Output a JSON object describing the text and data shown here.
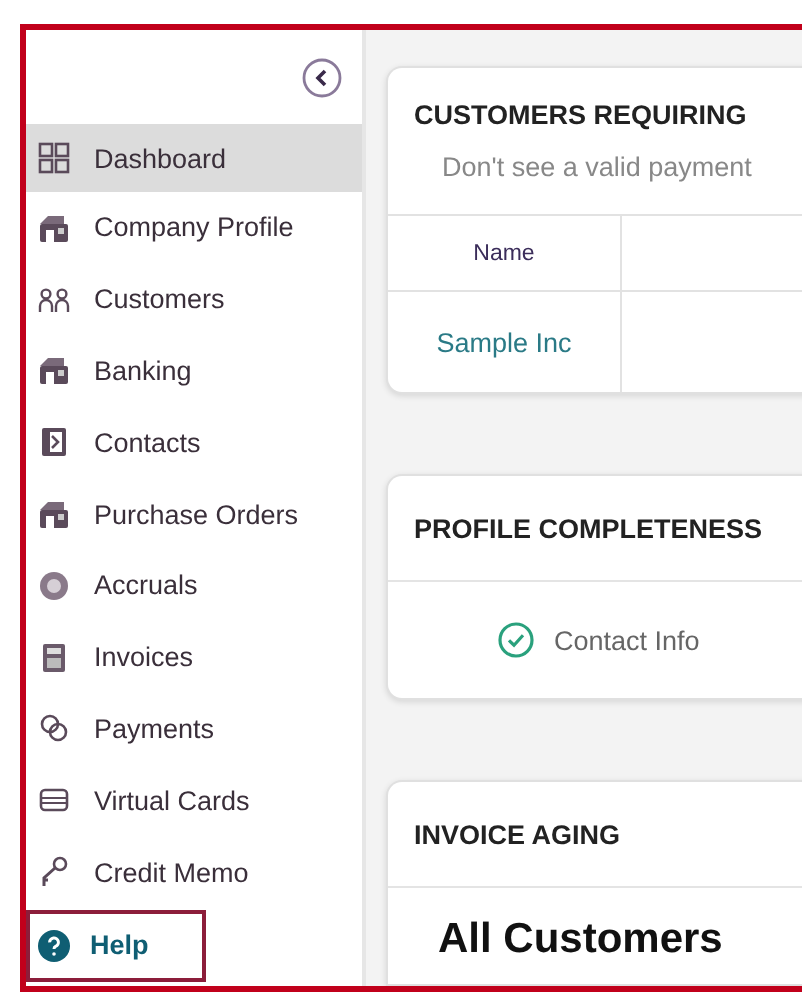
{
  "sidebar": {
    "items": [
      {
        "label": "Dashboard",
        "selected": true,
        "kind": "nav"
      },
      {
        "label": "Company Profile",
        "selected": false,
        "kind": "nav"
      },
      {
        "label": "Customers",
        "selected": false,
        "kind": "nav"
      },
      {
        "label": "Banking",
        "selected": false,
        "kind": "nav"
      },
      {
        "label": "Contacts",
        "selected": false,
        "kind": "nav"
      },
      {
        "label": "Purchase Orders",
        "selected": false,
        "kind": "nav"
      },
      {
        "label": "Accruals",
        "selected": false,
        "kind": "nav"
      },
      {
        "label": "Invoices",
        "selected": false,
        "kind": "nav"
      },
      {
        "label": "Payments",
        "selected": false,
        "kind": "nav"
      },
      {
        "label": "Virtual Cards",
        "selected": false,
        "kind": "nav"
      },
      {
        "label": "Credit Memo",
        "selected": false,
        "kind": "nav"
      },
      {
        "label": "Help",
        "selected": false,
        "kind": "help"
      }
    ]
  },
  "customers_card": {
    "title": "CUSTOMERS REQUIRING",
    "subtitle": "Don't see a valid payment",
    "table": {
      "columns": [
        "Name"
      ],
      "rows": [
        [
          "Sample Inc"
        ]
      ]
    }
  },
  "profile_card": {
    "title": "PROFILE COMPLETENESS",
    "items": [
      {
        "label": "Contact Info",
        "done": true
      }
    ]
  },
  "aging_card": {
    "title": "INVOICE AGING",
    "heading": "All Customers"
  }
}
